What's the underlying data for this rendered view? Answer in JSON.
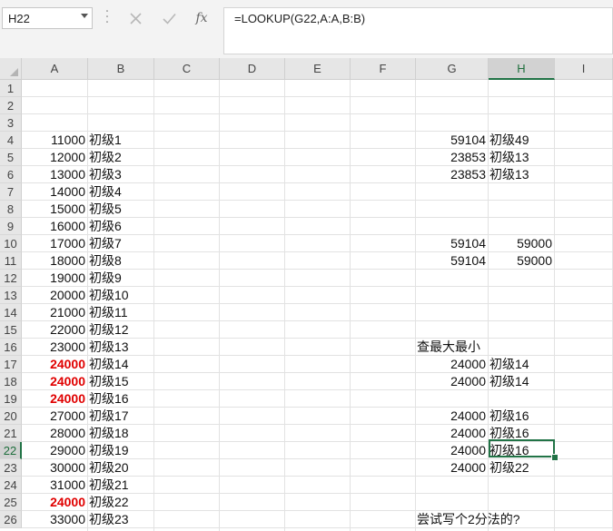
{
  "name_box": {
    "value": "H22"
  },
  "formula_bar": {
    "cancel_icon": "cancel-x-icon",
    "enter_icon": "check-icon",
    "fx_label": "fx",
    "formula": "=LOOKUP(G22,A:A,B:B)"
  },
  "columns": [
    "A",
    "B",
    "C",
    "D",
    "E",
    "F",
    "G",
    "H",
    "I"
  ],
  "rows": [
    "1",
    "2",
    "3",
    "4",
    "5",
    "6",
    "7",
    "8",
    "9",
    "10",
    "11",
    "12",
    "13",
    "14",
    "15",
    "16",
    "17",
    "18",
    "19",
    "20",
    "21",
    "22",
    "23",
    "24",
    "25",
    "26"
  ],
  "selected": {
    "column": "H",
    "row": "22"
  },
  "cells": [
    {
      "ref": "A4",
      "value": "11000"
    },
    {
      "ref": "B4",
      "value": "初级1"
    },
    {
      "ref": "A5",
      "value": "12000"
    },
    {
      "ref": "B5",
      "value": "初级2"
    },
    {
      "ref": "A6",
      "value": "13000"
    },
    {
      "ref": "B6",
      "value": "初级3"
    },
    {
      "ref": "A7",
      "value": "14000"
    },
    {
      "ref": "B7",
      "value": "初级4"
    },
    {
      "ref": "A8",
      "value": "15000"
    },
    {
      "ref": "B8",
      "value": "初级5"
    },
    {
      "ref": "A9",
      "value": "16000"
    },
    {
      "ref": "B9",
      "value": "初级6"
    },
    {
      "ref": "A10",
      "value": "17000"
    },
    {
      "ref": "B10",
      "value": "初级7"
    },
    {
      "ref": "A11",
      "value": "18000"
    },
    {
      "ref": "B11",
      "value": "初级8"
    },
    {
      "ref": "A12",
      "value": "19000"
    },
    {
      "ref": "B12",
      "value": "初级9"
    },
    {
      "ref": "A13",
      "value": "20000"
    },
    {
      "ref": "B13",
      "value": "初级10"
    },
    {
      "ref": "A14",
      "value": "21000"
    },
    {
      "ref": "B14",
      "value": "初级11"
    },
    {
      "ref": "A15",
      "value": "22000"
    },
    {
      "ref": "B15",
      "value": "初级12"
    },
    {
      "ref": "A16",
      "value": "23000"
    },
    {
      "ref": "B16",
      "value": "初级13"
    },
    {
      "ref": "A17",
      "value": "24000",
      "color": "#e00000"
    },
    {
      "ref": "B17",
      "value": "初级14"
    },
    {
      "ref": "A18",
      "value": "24000",
      "color": "#e00000"
    },
    {
      "ref": "B18",
      "value": "初级15"
    },
    {
      "ref": "A19",
      "value": "24000",
      "color": "#e00000"
    },
    {
      "ref": "B19",
      "value": "初级16"
    },
    {
      "ref": "A20",
      "value": "27000"
    },
    {
      "ref": "B20",
      "value": "初级17"
    },
    {
      "ref": "A21",
      "value": "28000"
    },
    {
      "ref": "B21",
      "value": "初级18"
    },
    {
      "ref": "A22",
      "value": "29000"
    },
    {
      "ref": "B22",
      "value": "初级19"
    },
    {
      "ref": "A23",
      "value": "30000"
    },
    {
      "ref": "B23",
      "value": "初级20"
    },
    {
      "ref": "A24",
      "value": "31000"
    },
    {
      "ref": "B24",
      "value": "初级21"
    },
    {
      "ref": "A25",
      "value": "24000",
      "color": "#e00000"
    },
    {
      "ref": "B25",
      "value": "初级22"
    },
    {
      "ref": "A26",
      "value": "33000"
    },
    {
      "ref": "B26",
      "value": "初级23"
    },
    {
      "ref": "G4",
      "value": "59104"
    },
    {
      "ref": "H4",
      "value": "初级49"
    },
    {
      "ref": "G5",
      "value": "23853"
    },
    {
      "ref": "H5",
      "value": "初级13"
    },
    {
      "ref": "G6",
      "value": "23853"
    },
    {
      "ref": "H6",
      "value": "初级13"
    },
    {
      "ref": "G10",
      "value": "59104"
    },
    {
      "ref": "H10",
      "value": "59000"
    },
    {
      "ref": "G11",
      "value": "59104"
    },
    {
      "ref": "H11",
      "value": "59000"
    },
    {
      "ref": "G16",
      "value": "查最大最小"
    },
    {
      "ref": "G17",
      "value": "24000"
    },
    {
      "ref": "H17",
      "value": "初级14"
    },
    {
      "ref": "G18",
      "value": "24000"
    },
    {
      "ref": "H18",
      "value": "初级14"
    },
    {
      "ref": "G20",
      "value": "24000"
    },
    {
      "ref": "H20",
      "value": "初级16"
    },
    {
      "ref": "G21",
      "value": "24000"
    },
    {
      "ref": "H21",
      "value": "初级16"
    },
    {
      "ref": "G22",
      "value": "24000"
    },
    {
      "ref": "H22",
      "value": "初级16"
    },
    {
      "ref": "G23",
      "value": "24000"
    },
    {
      "ref": "H23",
      "value": "初级22"
    },
    {
      "ref": "G26",
      "value": "尝试写个2分法的?"
    }
  ]
}
